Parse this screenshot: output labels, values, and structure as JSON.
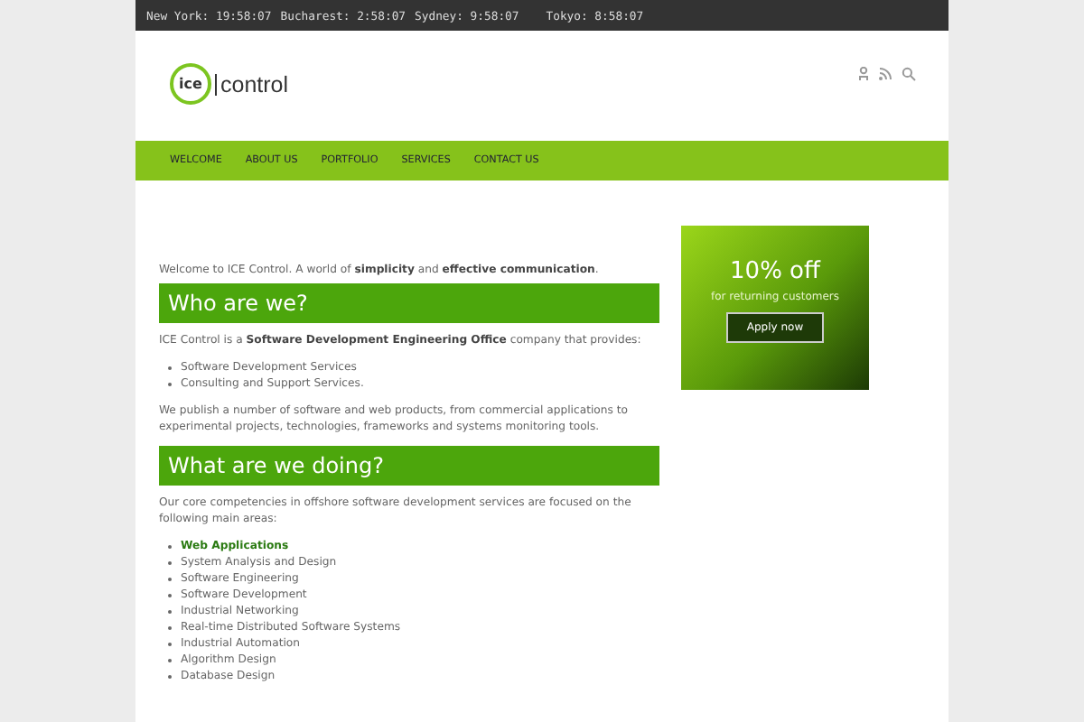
{
  "clocks": [
    {
      "city": "New York:",
      "time": "19:58:07"
    },
    {
      "city": "Bucharest:",
      "time": "2:58:07"
    },
    {
      "city": "Sydney:",
      "time": "9:58:07"
    },
    {
      "city": "Tokyo:",
      "time": "8:58:07"
    }
  ],
  "logo": {
    "mark": "ice",
    "name": "control"
  },
  "nav": [
    {
      "label": "WELCOME"
    },
    {
      "label": "ABOUT US"
    },
    {
      "label": "PORTFOLIO"
    },
    {
      "label": "SERVICES"
    },
    {
      "label": "CONTACT US"
    }
  ],
  "intro": "Welcome to ICE Control. A world of **simplicity** and **effective communication**.",
  "sections": [
    {
      "heading": "Who are we?",
      "lead": "ICE Control is a **Software Development Engineering Office** company that provides:",
      "items": [
        {
          "text": "Software Development Services",
          "kind": "text"
        },
        {
          "text": "Consulting and Support Services.",
          "kind": "text"
        }
      ],
      "after": "We publish a number of software and web products, from commercial applications to experimental projects, technologies, frameworks and systems monitoring tools."
    },
    {
      "heading": "What are we doing?",
      "lead": "Our core competencies in offshore software development services are focused on the following main areas:",
      "items": [
        {
          "text": "Web Applications",
          "kind": "link"
        },
        {
          "text": "System Analysis and Design",
          "kind": "text"
        },
        {
          "text": "Software Engineering",
          "kind": "text"
        },
        {
          "text": "Software Development",
          "kind": "text"
        },
        {
          "text": "Industrial Networking",
          "kind": "text"
        },
        {
          "text": "Real-time Distributed Software Systems",
          "kind": "text"
        },
        {
          "text": "Industrial Automation",
          "kind": "text"
        },
        {
          "text": "Algorithm Design",
          "kind": "text"
        },
        {
          "text": "Database Design",
          "kind": "text"
        }
      ]
    }
  ],
  "promo": {
    "title": "10% off",
    "subtitle": "for returning customers",
    "button": "Apply now"
  }
}
